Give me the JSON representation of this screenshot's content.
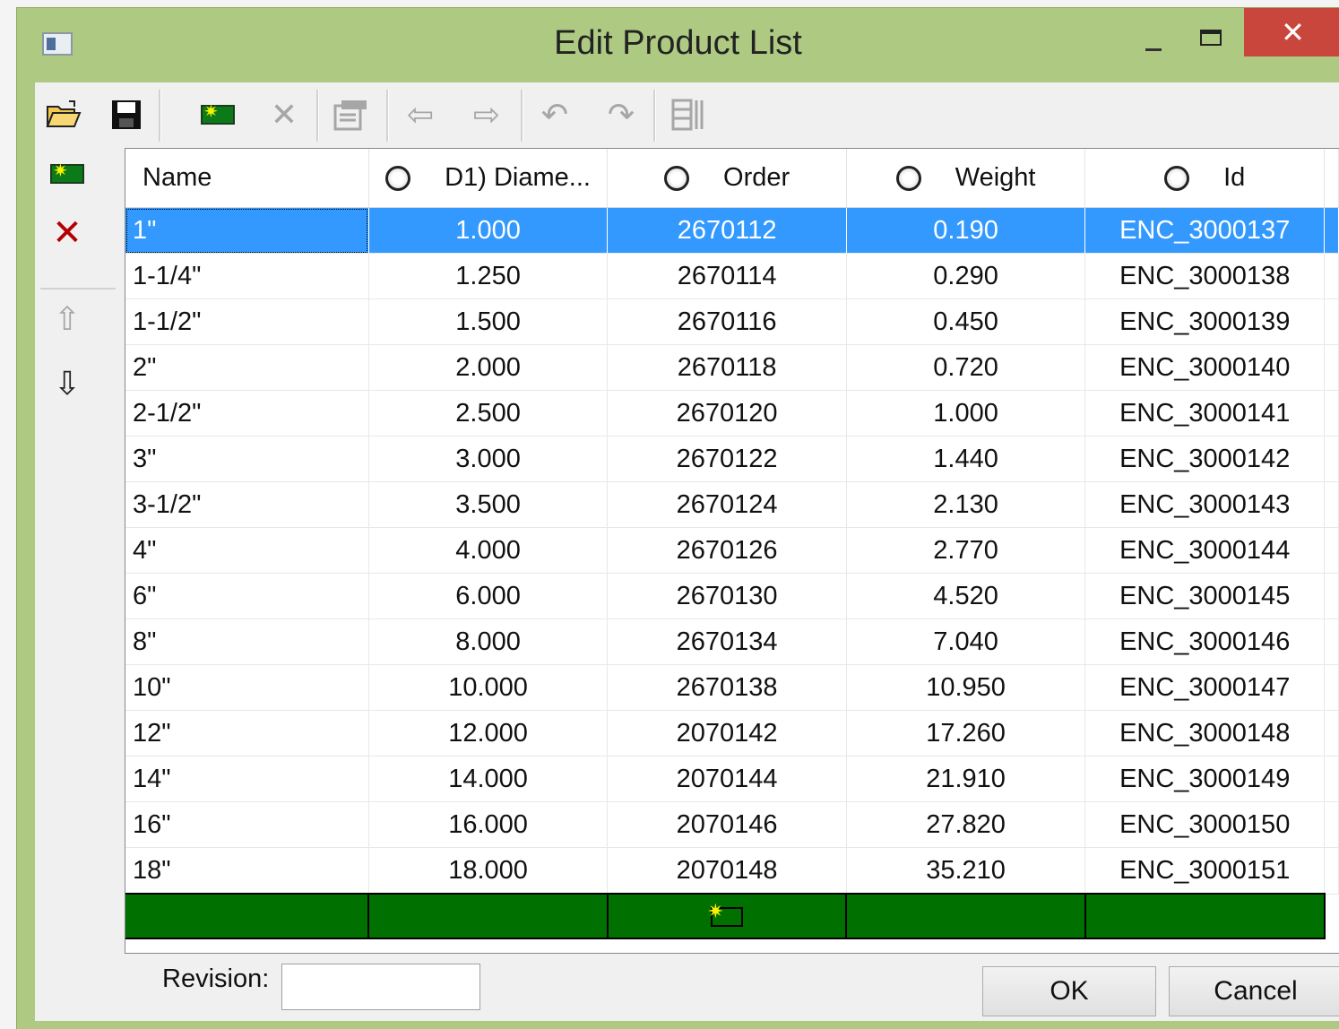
{
  "window": {
    "title": "Edit Product List",
    "close_glyph": "✕"
  },
  "toolbar": {
    "buttons": [
      "open-folder-icon",
      "save-icon",
      "add-record-icon",
      "delete-icon",
      "properties-icon",
      "arrow-left-icon",
      "arrow-right-icon",
      "undo-icon",
      "redo-icon",
      "columns-icon"
    ]
  },
  "sidebar": {
    "buttons": [
      "add-row-icon",
      "delete-row-icon",
      "move-up-icon",
      "move-down-icon"
    ]
  },
  "grid": {
    "columns": [
      "Name",
      "D1) Diame...",
      "Order",
      "Weight",
      "Id"
    ],
    "selected_row": 0,
    "rows": [
      {
        "name": "1\"",
        "diameter": "1.000",
        "order": "2670112",
        "weight": "0.190",
        "id": "ENC_3000137"
      },
      {
        "name": "1-1/4\"",
        "diameter": "1.250",
        "order": "2670114",
        "weight": "0.290",
        "id": "ENC_3000138"
      },
      {
        "name": "1-1/2\"",
        "diameter": "1.500",
        "order": "2670116",
        "weight": "0.450",
        "id": "ENC_3000139"
      },
      {
        "name": "2\"",
        "diameter": "2.000",
        "order": "2670118",
        "weight": "0.720",
        "id": "ENC_3000140"
      },
      {
        "name": "2-1/2\"",
        "diameter": "2.500",
        "order": "2670120",
        "weight": "1.000",
        "id": "ENC_3000141"
      },
      {
        "name": "3\"",
        "diameter": "3.000",
        "order": "2670122",
        "weight": "1.440",
        "id": "ENC_3000142"
      },
      {
        "name": "3-1/2\"",
        "diameter": "3.500",
        "order": "2670124",
        "weight": "2.130",
        "id": "ENC_3000143"
      },
      {
        "name": "4\"",
        "diameter": "4.000",
        "order": "2670126",
        "weight": "2.770",
        "id": "ENC_3000144"
      },
      {
        "name": "6\"",
        "diameter": "6.000",
        "order": "2670130",
        "weight": "4.520",
        "id": "ENC_3000145"
      },
      {
        "name": "8\"",
        "diameter": "8.000",
        "order": "2670134",
        "weight": "7.040",
        "id": "ENC_3000146"
      },
      {
        "name": "10\"",
        "diameter": "10.000",
        "order": "2670138",
        "weight": "10.950",
        "id": "ENC_3000147"
      },
      {
        "name": "12\"",
        "diameter": "12.000",
        "order": "2070142",
        "weight": "17.260",
        "id": "ENC_3000148"
      },
      {
        "name": "14\"",
        "diameter": "14.000",
        "order": "2070144",
        "weight": "21.910",
        "id": "ENC_3000149"
      },
      {
        "name": "16\"",
        "diameter": "16.000",
        "order": "2070146",
        "weight": "27.820",
        "id": "ENC_3000150"
      },
      {
        "name": "18\"",
        "diameter": "18.000",
        "order": "2070148",
        "weight": "35.210",
        "id": "ENC_3000151"
      }
    ]
  },
  "footer": {
    "revision_label": "Revision:",
    "revision_value": "",
    "ok_label": "OK",
    "cancel_label": "Cancel"
  },
  "colors": {
    "titlebar": "#aeca82",
    "selection": "#3399ff",
    "new_row": "#007000",
    "close_button": "#c9463d"
  }
}
